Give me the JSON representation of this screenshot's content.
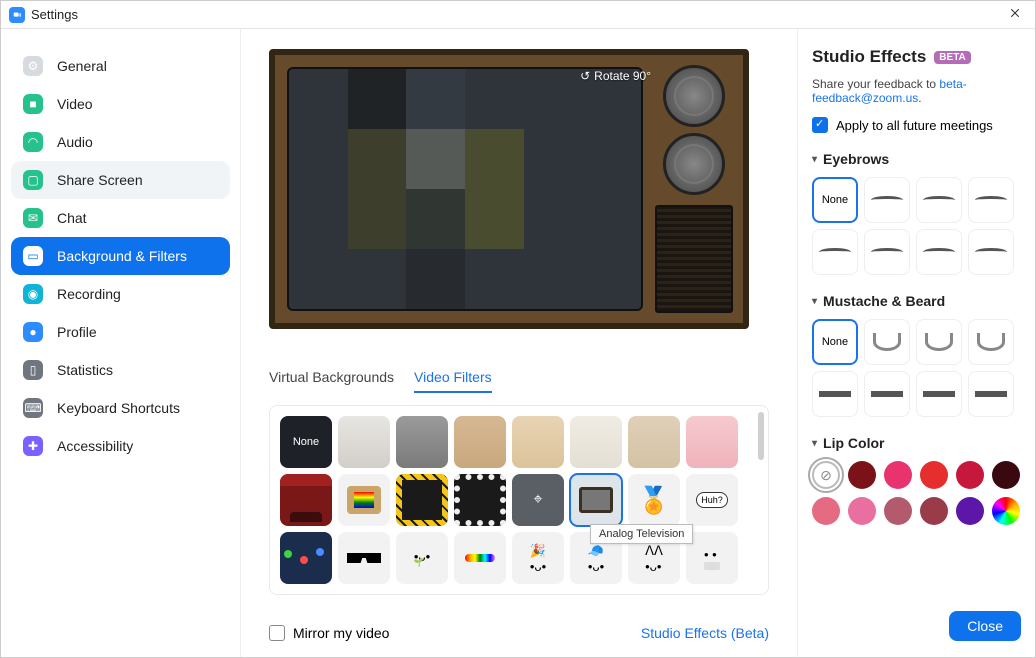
{
  "title": "Settings",
  "sidebar": {
    "items": [
      {
        "label": "General",
        "icon": "gear-icon",
        "color": "gray"
      },
      {
        "label": "Video",
        "icon": "video-icon",
        "color": "teal"
      },
      {
        "label": "Audio",
        "icon": "headphones-icon",
        "color": "teal"
      },
      {
        "label": "Share Screen",
        "icon": "share-screen-icon",
        "color": "teal",
        "selected_light": true
      },
      {
        "label": "Chat",
        "icon": "chat-icon",
        "color": "teal"
      },
      {
        "label": "Background & Filters",
        "icon": "profile-card-icon",
        "color": "blue",
        "active": true
      },
      {
        "label": "Recording",
        "icon": "record-icon",
        "color": "cyan"
      },
      {
        "label": "Profile",
        "icon": "person-icon",
        "color": "blue"
      },
      {
        "label": "Statistics",
        "icon": "bars-icon",
        "color": "darkgray"
      },
      {
        "label": "Keyboard Shortcuts",
        "icon": "keyboard-icon",
        "color": "darkgray"
      },
      {
        "label": "Accessibility",
        "icon": "accessibility-icon",
        "color": "purple"
      }
    ]
  },
  "preview": {
    "rotate_label": "Rotate 90°"
  },
  "tabs": {
    "virtual_backgrounds": "Virtual Backgrounds",
    "video_filters": "Video Filters"
  },
  "filters": {
    "none_label": "None",
    "items": [
      "none",
      "neutral-1",
      "gray",
      "tan",
      "warm",
      "cream",
      "beige",
      "pink",
      "theater",
      "retro-tv",
      "emoji-frame",
      "pearl-frame",
      "target-frame",
      "analog-tv",
      "ribbon",
      "speech-huh",
      "string-lights",
      "pixel-shades",
      "sprout",
      "rainbow",
      "party-hat",
      "cap",
      "cat-ears",
      "mask"
    ],
    "selected_index": 13,
    "tooltip": "Analog Television",
    "huh_text": "Huh?"
  },
  "mirror": {
    "label": "Mirror my video",
    "checked": false
  },
  "studio_effects_link": "Studio Effects (Beta)",
  "studio": {
    "title": "Studio Effects",
    "beta_label": "BETA",
    "feedback_prefix": "Share your feedback to ",
    "feedback_link": "beta-feedback@zoom.us",
    "feedback_suffix": ".",
    "apply_label": "Apply to all future meetings",
    "apply_checked": true,
    "sections": {
      "eyebrows": {
        "label": "Eyebrows",
        "none": "None",
        "count": 8
      },
      "mustache": {
        "label": "Mustache & Beard",
        "none": "None",
        "count": 8
      },
      "lip": {
        "label": "Lip Color"
      }
    },
    "lip_colors": [
      "none",
      "#7a1218",
      "#e8336f",
      "#e62e2e",
      "#c5183c",
      "#3a0910",
      "#e46b82",
      "#e86fa0",
      "#b45a6e",
      "#9a3b4a",
      "#5c16a8",
      "rainbow"
    ]
  },
  "close_label": "Close"
}
